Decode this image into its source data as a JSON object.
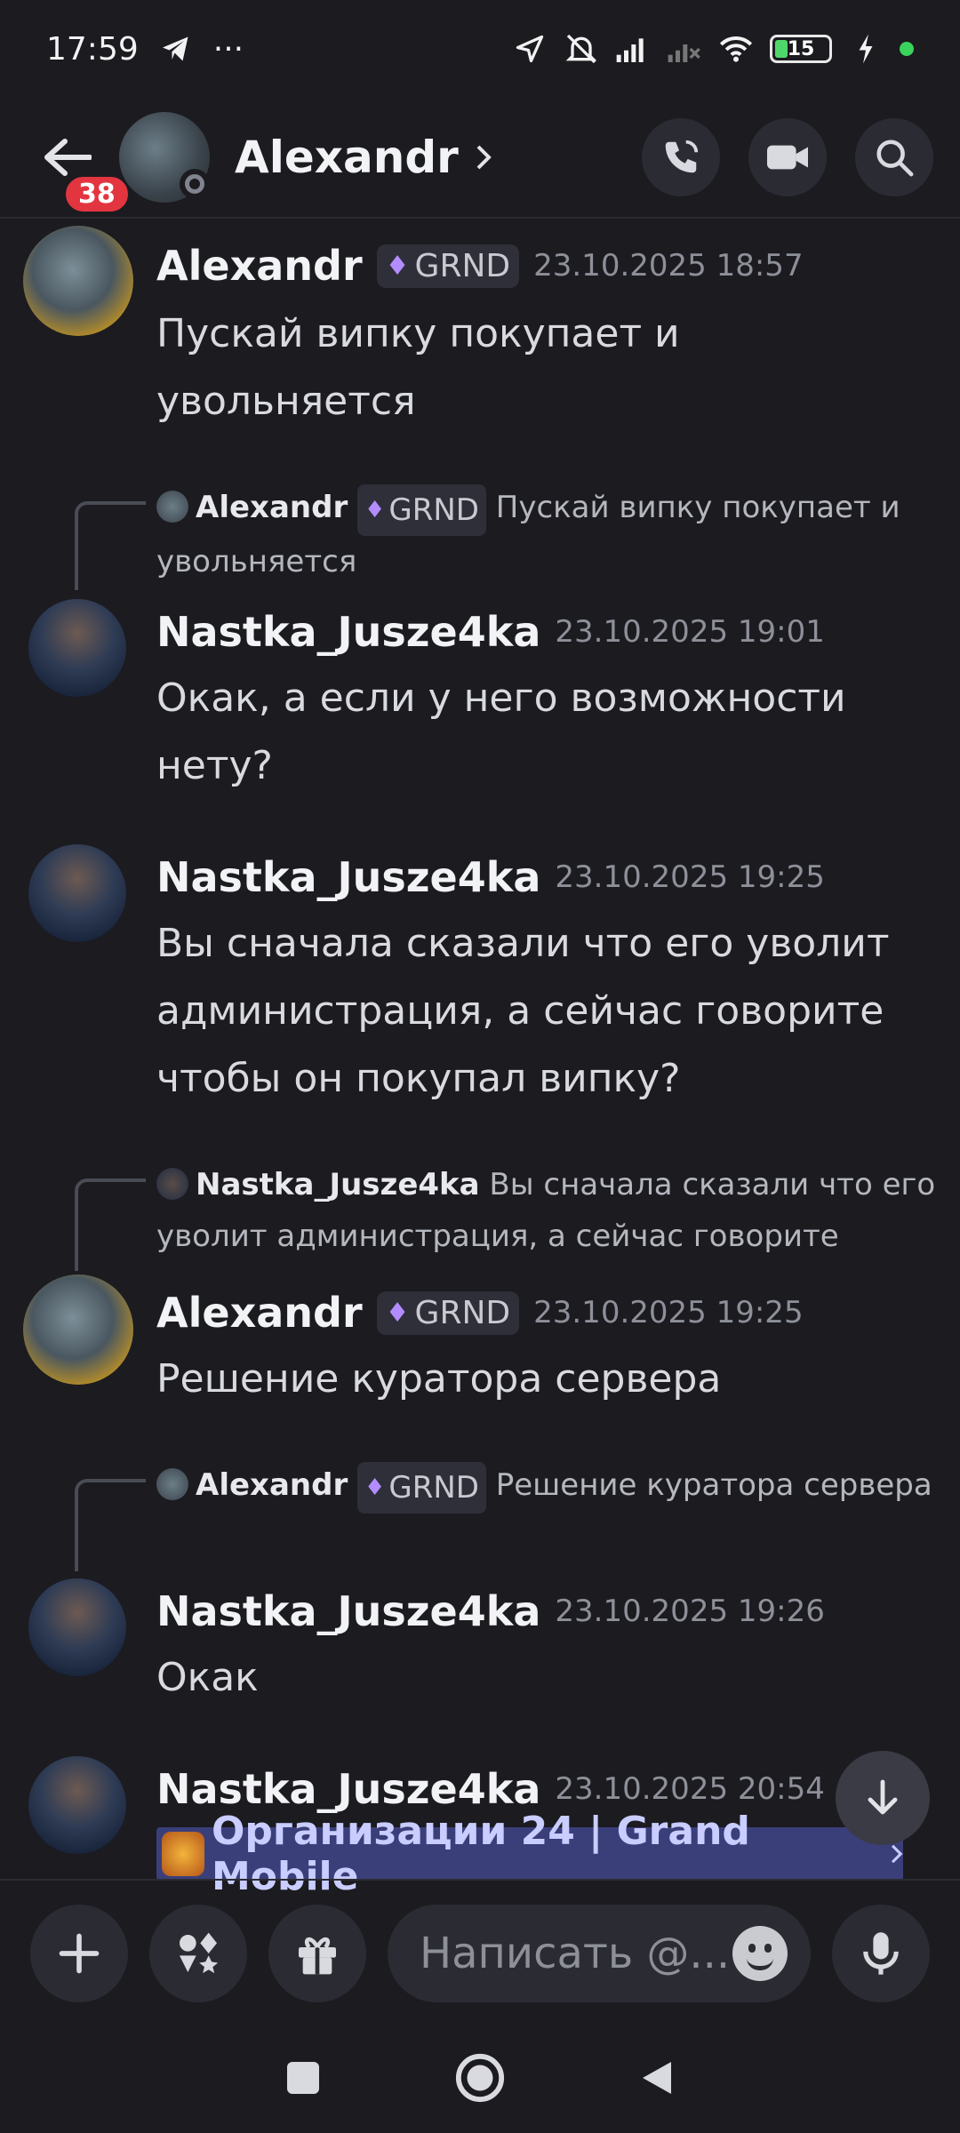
{
  "status_bar": {
    "time": "17:59",
    "more": "···",
    "battery": "15"
  },
  "header": {
    "unread_count": "38",
    "title": "Alexandr"
  },
  "messages": [
    {
      "author": "Alexandr",
      "tag": "GRND",
      "time": "23.10.2025 18:57",
      "text": "Пускай випку покупает и увольняется"
    },
    {
      "reply": {
        "author": "Alexandr",
        "tag": "GRND",
        "text": "Пускай випку покупает и увольняется"
      },
      "author": "Nastka_Jusze4ka",
      "time": "23.10.2025 19:01",
      "text": "Окак, а если у него возможности нету?"
    },
    {
      "author": "Nastka_Jusze4ka",
      "time": "23.10.2025 19:25",
      "text": "Вы сначала сказали что его уволит администрация, а сейчас говорите чтобы он покупал випку?"
    },
    {
      "reply": {
        "author": "Nastka_Jusze4ka",
        "text": "Вы сначала сказали что его уволит администрация, а сейчас говорите"
      },
      "author": "Alexandr",
      "tag": "GRND",
      "time": "23.10.2025 19:25",
      "text": "Решение куратора сервера"
    },
    {
      "reply": {
        "author": "Alexandr",
        "tag": "GRND",
        "text": "Решение куратора сервера"
      },
      "author": "Nastka_Jusze4ka",
      "time": "23.10.2025 19:26",
      "text": "Окак"
    },
    {
      "author": "Nastka_Jusze4ka",
      "time": "23.10.2025 20:54",
      "embed": "Организации 24 | Grand Mobile"
    }
  ],
  "input": {
    "placeholder": "Написать @..."
  },
  "colors": {
    "accent": "#5865f2",
    "badge": "#e3353f",
    "background": "#1b1b20"
  }
}
